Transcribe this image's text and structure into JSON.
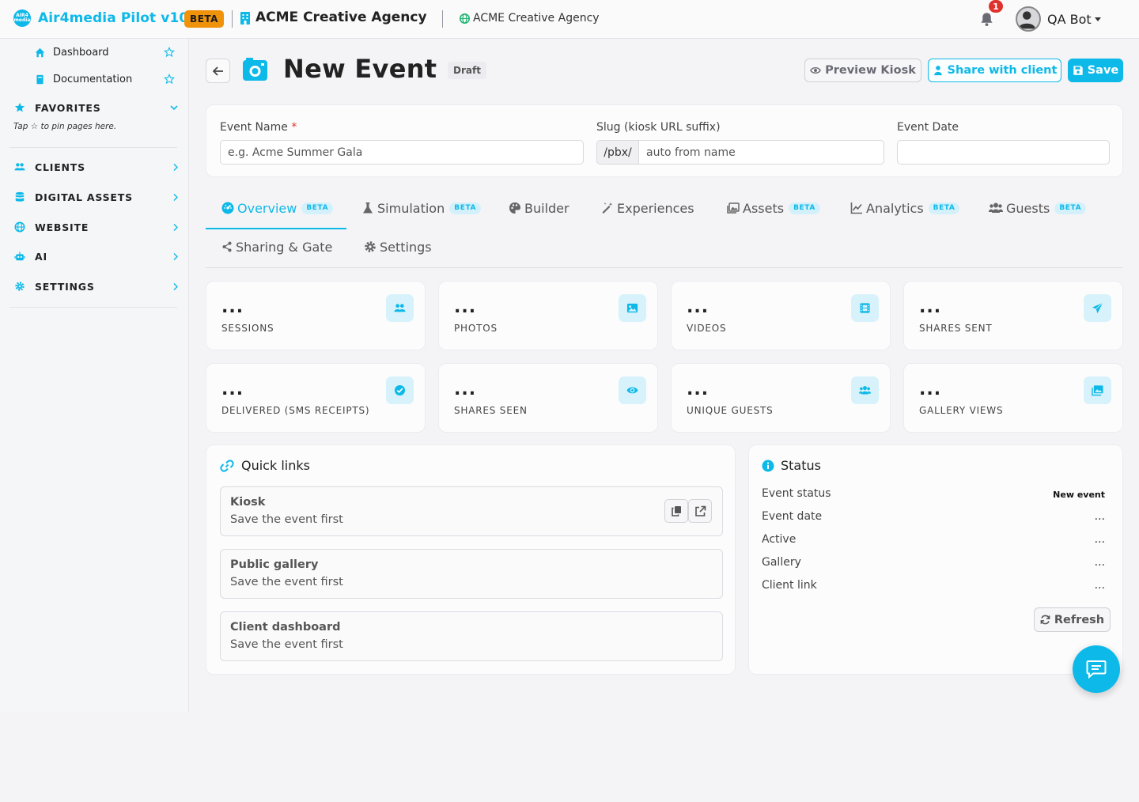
{
  "topbar": {
    "logo_text": "AIR4\nmedia",
    "app_name": "Air4media Pilot v10",
    "beta_label": "BETA",
    "org_name": "ACME Creative Agency",
    "site_name": "ACME Creative Agency",
    "notifications_count": "1",
    "user_name": "QA Bot",
    "icons": [
      "building-icon",
      "globe-icon",
      "bell-icon",
      "avatar",
      "caret-down-icon"
    ]
  },
  "sidebar": {
    "links": [
      {
        "label": "Dashboard",
        "icon": "home-icon"
      },
      {
        "label": "Documentation",
        "icon": "book-icon"
      }
    ],
    "favorites_label": "FAVORITES",
    "favorites_hint": "Tap ☆ to pin pages here.",
    "sections": [
      {
        "label": "CLIENTS",
        "icon": "users-icon"
      },
      {
        "label": "DIGITAL ASSETS",
        "icon": "database-icon"
      },
      {
        "label": "WEBSITE",
        "icon": "globe-icon"
      },
      {
        "label": "AI",
        "icon": "robot-icon"
      },
      {
        "label": "SETTINGS",
        "icon": "gear-icon"
      }
    ]
  },
  "header": {
    "title": "New Event",
    "status_badge": "Draft",
    "preview_label": "Preview Kiosk",
    "share_label": "Share with client",
    "save_label": "Save"
  },
  "form": {
    "event_name_label": "Event Name",
    "required_mark": "*",
    "event_name_placeholder": "e.g. Acme Summer Gala",
    "slug_label": "Slug (kiosk URL suffix)",
    "slug_prefix": "/pbx/",
    "slug_placeholder": "auto from name",
    "event_date_label": "Event Date",
    "event_date_value": ""
  },
  "tabs": [
    {
      "label": "Overview",
      "beta": "BETA",
      "active": true,
      "icon": "gauge-icon"
    },
    {
      "label": "Simulation",
      "beta": "BETA",
      "icon": "flask-icon"
    },
    {
      "label": "Builder",
      "beta": "",
      "icon": "palette-icon"
    },
    {
      "label": "Experiences",
      "beta": "",
      "icon": "magic-wand-icon"
    },
    {
      "label": "Assets",
      "beta": "BETA",
      "icon": "images-icon"
    },
    {
      "label": "Analytics",
      "beta": "BETA",
      "icon": "chart-line-icon"
    },
    {
      "label": "Guests",
      "beta": "BETA",
      "icon": "users-icon"
    },
    {
      "label": "Sharing & Gate",
      "beta": "",
      "icon": "share-icon"
    },
    {
      "label": "Settings",
      "beta": "",
      "icon": "gear-icon"
    }
  ],
  "stats": [
    {
      "value": "...",
      "label": "SESSIONS",
      "icon": "users-icon"
    },
    {
      "value": "...",
      "label": "PHOTOS",
      "icon": "image-icon"
    },
    {
      "value": "...",
      "label": "VIDEOS",
      "icon": "film-icon"
    },
    {
      "value": "...",
      "label": "SHARES SENT",
      "icon": "paper-plane-icon"
    },
    {
      "value": "...",
      "label": "DELIVERED (SMS RECEIPTS)",
      "icon": "check-circle-icon"
    },
    {
      "value": "...",
      "label": "SHARES SEEN",
      "icon": "eye-icon"
    },
    {
      "value": "...",
      "label": "UNIQUE GUESTS",
      "icon": "users-icon"
    },
    {
      "value": "...",
      "label": "GALLERY VIEWS",
      "icon": "images-icon"
    }
  ],
  "quick_links": {
    "title": "Quick links",
    "items": [
      {
        "title": "Kiosk",
        "subtitle": "Save the event first"
      },
      {
        "title": "Public gallery",
        "subtitle": "Save the event first"
      },
      {
        "title": "Client dashboard",
        "subtitle": "Save the event first"
      }
    ]
  },
  "status": {
    "title": "Status",
    "rows": [
      {
        "key": "Event status",
        "value": "New event"
      },
      {
        "key": "Event date",
        "value": "..."
      },
      {
        "key": "Active",
        "value": "..."
      },
      {
        "key": "Gallery",
        "value": "..."
      },
      {
        "key": "Client link",
        "value": "..."
      }
    ],
    "refresh_label": "Refresh"
  },
  "colors": {
    "accent": "#0db9e8",
    "beta_badge": "#f0930a",
    "notification_badge": "#e0322c"
  }
}
